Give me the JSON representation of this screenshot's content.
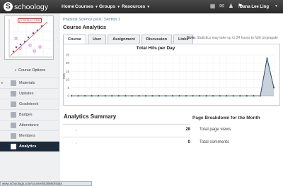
{
  "header": {
    "logo_text": "schoology",
    "logo_letter": "S",
    "nav": [
      {
        "label": "Home"
      },
      {
        "label": "Courses"
      },
      {
        "label": "Groups"
      },
      {
        "label": "Resources"
      }
    ],
    "user_name": "Dana Lee Ling"
  },
  "sidebar": {
    "course_options_label": "Course Options",
    "thumbnail_label": "y = 26.29 x + 13.64",
    "items": [
      {
        "label": "Materials"
      },
      {
        "label": "Updates"
      },
      {
        "label": "Gradebook"
      },
      {
        "label": "Badges"
      },
      {
        "label": "Attendance"
      },
      {
        "label": "Members"
      },
      {
        "label": "Analytics"
      }
    ]
  },
  "main": {
    "breadcrumb": "Physical Science ps01: Section 1",
    "title": "Course Analytics",
    "tabs": [
      {
        "label": "Course"
      },
      {
        "label": "User"
      },
      {
        "label": "Assignment"
      },
      {
        "label": "Discussion"
      },
      {
        "label": "Links"
      }
    ],
    "note_bold": "Note:",
    "note_text": "Statistics may take up to 24 hours to fully propagate",
    "summary_title": "Analytics Summary",
    "breakdown_title": "Page Breakdown for the Month",
    "summary_rows": [
      {
        "value": "28",
        "label": "Total page views"
      },
      {
        "value": "0",
        "label": "Total comments"
      }
    ]
  },
  "status_url": "www.schoology.com/course/5539560/stats",
  "chart_data": {
    "type": "area",
    "title": "Total Hits per Day",
    "ylabel": "Hits",
    "ylim": [
      0,
      25
    ],
    "yticks": [
      0,
      5,
      10,
      15,
      20,
      25
    ],
    "x": [
      1,
      2,
      3,
      4,
      5,
      6,
      7,
      8,
      9,
      10,
      11,
      12,
      13,
      14,
      15,
      16,
      17,
      18,
      19,
      20,
      21,
      22,
      23,
      24,
      25,
      26,
      27,
      28,
      29,
      30,
      31
    ],
    "values": [
      0,
      0,
      0,
      0,
      0,
      0,
      0,
      0,
      0,
      0,
      0,
      0,
      0,
      0,
      0,
      0,
      0,
      0,
      0,
      0,
      0,
      0,
      0,
      0,
      0,
      0,
      0,
      0,
      0,
      23,
      5
    ],
    "grid": true,
    "color": "#2d4e6e"
  }
}
